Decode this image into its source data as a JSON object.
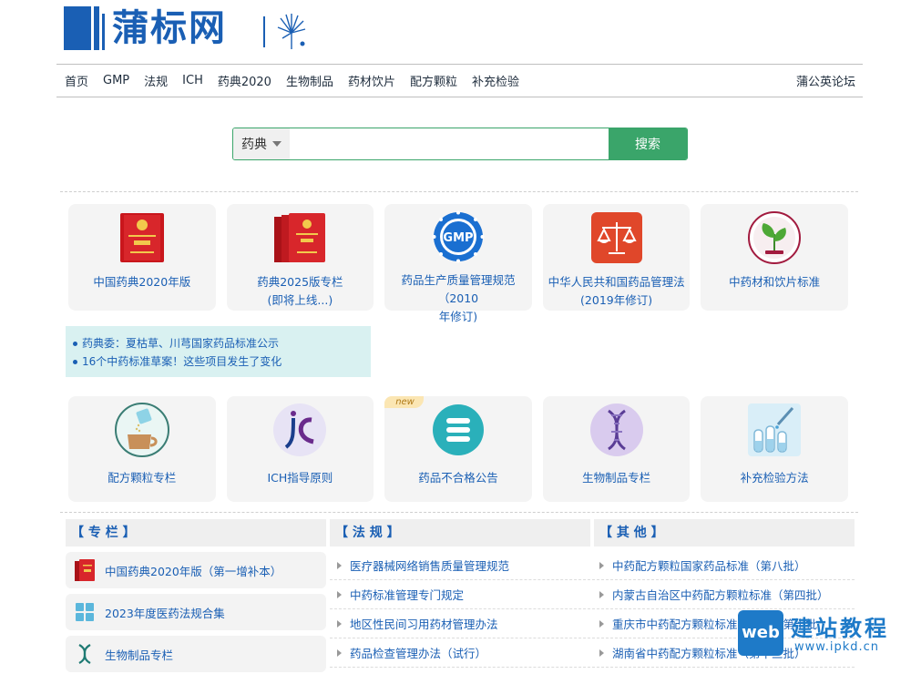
{
  "header": {
    "logo_text": "蒲标网"
  },
  "nav": {
    "items": [
      "首页",
      "GMP",
      "法规",
      "ICH",
      "药典2020",
      "生物制品",
      "药材饮片",
      "配方颗粒",
      "补充检验"
    ],
    "right": "蒲公英论坛"
  },
  "search": {
    "category": "药典",
    "placeholder": "",
    "button": "搜索"
  },
  "cards_row1": [
    {
      "label": "中国药典2020年版",
      "label2": "",
      "icon": "pharmacopoeia-2020-book-icon"
    },
    {
      "label": "药典2025版专栏",
      "label2": "(即将上线...)",
      "icon": "pharmacopoeia-2025-books-icon"
    },
    {
      "label": "药品生产质量管理规范（2010",
      "label2": "年修订)",
      "icon": "gmp-badge-icon"
    },
    {
      "label": "中华人民共和国药品管理法",
      "label2": "(2019年修订)",
      "icon": "scales-icon"
    },
    {
      "label": "中药材和饮片标准",
      "label2": "",
      "icon": "herb-leaf-icon"
    }
  ],
  "notice": [
    "药典委：夏枯草、川芎国家药品标准公示",
    "16个中药标准草案！这些项目发生了变化"
  ],
  "cards_row2": [
    {
      "label": "配方颗粒专栏",
      "icon": "granule-cup-icon",
      "badge": ""
    },
    {
      "label": "ICH指导原则",
      "icon": "ich-logo-icon",
      "badge": ""
    },
    {
      "label": "药品不合格公告",
      "icon": "stack-icon",
      "badge": "new"
    },
    {
      "label": "生物制品专栏",
      "icon": "dna-icon",
      "badge": ""
    },
    {
      "label": "补充检验方法",
      "icon": "test-tubes-icon",
      "badge": ""
    }
  ],
  "columns": {
    "special_title": "【 专 栏 】",
    "laws_title": "【 法 规 】",
    "other_title": "【 其 他 】"
  },
  "special": [
    {
      "label": "中国药典2020年版（第一增补本）",
      "icon": "pharmacopoeia-book-icon"
    },
    {
      "label": "2023年度医药法规合集",
      "icon": "grid-icon"
    },
    {
      "label": "生物制品专栏",
      "icon": "dna-icon"
    }
  ],
  "laws": [
    "医疗器械网络销售质量管理规范",
    "中药标准管理专门规定",
    "地区性民间习用药材管理办法",
    "药品检查管理办法（试行）"
  ],
  "others": [
    "中药配方颗粒国家药品标准（第八批）",
    "内蒙古自治区中药配方颗粒标准（第四批）",
    "重庆市中药配方颗粒标准（试行）第十批",
    "湖南省中药配方颗粒标准（第十三批）"
  ],
  "watermark": {
    "box": "web",
    "title": "建站教程",
    "url": "www.ipkd.cn"
  },
  "colors": {
    "brand_blue": "#1a5fb4",
    "search_green": "#3aa56a",
    "notice_bg": "#d9f1f1"
  }
}
